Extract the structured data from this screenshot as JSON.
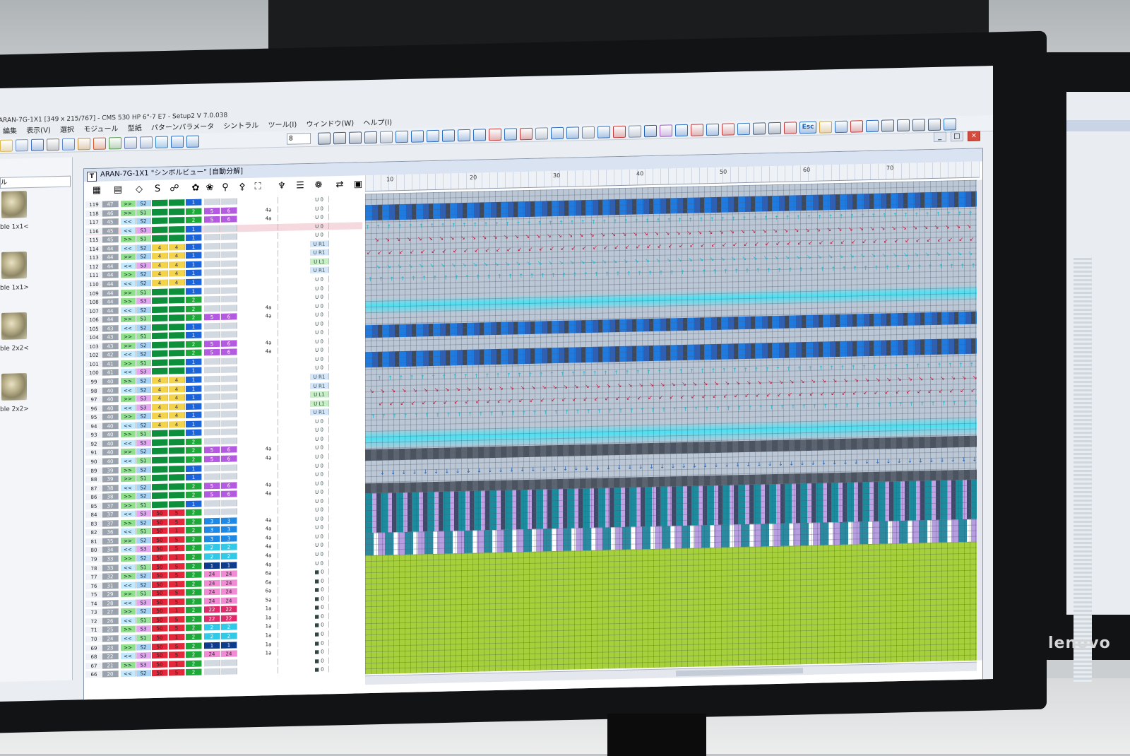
{
  "app": {
    "title": "ARAN-7G-1X1 [349 x 215/767] - CMS 530 HP 6\"-7 E7 - Setup2   V 7.0.038",
    "menu": [
      "編集",
      "表示(V)",
      "選択",
      "モジュール",
      "型紙",
      "パターンパラメータ",
      "シントラル",
      "ツール(I)",
      "ウィンドウ(W)",
      "ヘルプ(I)"
    ],
    "zoom_value": "8",
    "esc_label": "Esc",
    "window_controls": [
      "_",
      "□",
      "×"
    ]
  },
  "left_pane": {
    "combo_value": "ル",
    "thumbnails": [
      {
        "label": "ble 1x1<"
      },
      {
        "label": "ble 1x1>"
      },
      {
        "label": "ble 2x2<"
      },
      {
        "label": "ble 2x2>"
      }
    ]
  },
  "child_window": {
    "title": "ARAN-7G-1X1 \"シンボルビュー\" [自動分解]",
    "title_icon": "T",
    "toolbar_glyphs": [
      "▦",
      "▤",
      "◇",
      "S",
      "☍",
      "✿",
      "❀",
      "⚲",
      "⚴",
      "⛶",
      "♆",
      "☰",
      "❁",
      "⇄",
      "▣"
    ],
    "ruler_labels": [
      "10",
      "20",
      "30",
      "40",
      "50",
      "60",
      "70"
    ]
  },
  "rows": [
    {
      "n": "119",
      "a": "47",
      "b": ">>",
      "c": "S2",
      "d": "",
      "e": "",
      "f": "1",
      "g": "",
      "h": "",
      "i": "",
      "j": "U 0"
    },
    {
      "n": "118",
      "a": "46",
      "b": ">>",
      "c": "S1",
      "d": "",
      "e": "",
      "f": "2",
      "g": "5",
      "h": "6",
      "i": "4a",
      "j": "U 0"
    },
    {
      "n": "117",
      "a": "45",
      "b": "<<",
      "c": "S2",
      "d": "",
      "e": "",
      "f": "2",
      "g": "5",
      "h": "6",
      "i": "4a",
      "j": "U 0"
    },
    {
      "n": "116",
      "a": "45",
      "b": "<<",
      "c": "S3",
      "d": "",
      "e": "",
      "f": "1",
      "g": "",
      "h": "",
      "i": "",
      "j": "U 0",
      "hl": true
    },
    {
      "n": "115",
      "a": "45",
      "b": ">>",
      "c": "S1",
      "d": "",
      "e": "",
      "f": "1",
      "g": "",
      "h": "",
      "i": "",
      "j": "U 0"
    },
    {
      "n": "114",
      "a": "44",
      "b": "<<",
      "c": "S2",
      "d": "4",
      "e": "4",
      "f": "1",
      "g": "",
      "h": "",
      "i": "",
      "j": "U R1"
    },
    {
      "n": "113",
      "a": "44",
      "b": ">>",
      "c": "S2",
      "d": "4",
      "e": "4",
      "f": "1",
      "g": "",
      "h": "",
      "i": "",
      "j": "U R1"
    },
    {
      "n": "112",
      "a": "44",
      "b": "<<",
      "c": "S3",
      "d": "4",
      "e": "4",
      "f": "1",
      "g": "",
      "h": "",
      "i": "",
      "j": "U L1"
    },
    {
      "n": "111",
      "a": "44",
      "b": ">>",
      "c": "S2",
      "d": "4",
      "e": "4",
      "f": "1",
      "g": "",
      "h": "",
      "i": "",
      "j": "U R1"
    },
    {
      "n": "110",
      "a": "44",
      "b": "<<",
      "c": "S2",
      "d": "4",
      "e": "4",
      "f": "1",
      "g": "",
      "h": "",
      "i": "",
      "j": "U 0"
    },
    {
      "n": "109",
      "a": "44",
      "b": ">>",
      "c": "S1",
      "d": "",
      "e": "",
      "f": "1",
      "g": "",
      "h": "",
      "i": "",
      "j": "U 0"
    },
    {
      "n": "108",
      "a": "44",
      "b": ">>",
      "c": "S3",
      "d": "",
      "e": "",
      "f": "2",
      "g": "",
      "h": "",
      "i": "",
      "j": "U 0"
    },
    {
      "n": "107",
      "a": "44",
      "b": "<<",
      "c": "S2",
      "d": "",
      "e": "",
      "f": "2",
      "g": "",
      "h": "",
      "i": "4a",
      "j": "U 0"
    },
    {
      "n": "106",
      "a": "44",
      "b": ">>",
      "c": "S1",
      "d": "",
      "e": "",
      "f": "2",
      "g": "5",
      "h": "6",
      "i": "4a",
      "j": "U 0"
    },
    {
      "n": "105",
      "a": "43",
      "b": "<<",
      "c": "S2",
      "d": "",
      "e": "",
      "f": "1",
      "g": "",
      "h": "",
      "i": "",
      "j": "U 0"
    },
    {
      "n": "104",
      "a": "43",
      "b": ">>",
      "c": "S1",
      "d": "",
      "e": "",
      "f": "1",
      "g": "",
      "h": "",
      "i": "",
      "j": "U 0"
    },
    {
      "n": "103",
      "a": "43",
      "b": ">>",
      "c": "S2",
      "d": "",
      "e": "",
      "f": "2",
      "g": "5",
      "h": "6",
      "i": "4a",
      "j": "U 0"
    },
    {
      "n": "102",
      "a": "42",
      "b": "<<",
      "c": "S2",
      "d": "",
      "e": "",
      "f": "2",
      "g": "5",
      "h": "6",
      "i": "4a",
      "j": "U 0"
    },
    {
      "n": "101",
      "a": "41",
      "b": ">>",
      "c": "S1",
      "d": "",
      "e": "",
      "f": "1",
      "g": "",
      "h": "",
      "i": "",
      "j": "U 0"
    },
    {
      "n": "100",
      "a": "41",
      "b": "<<",
      "c": "S3",
      "d": "",
      "e": "",
      "f": "1",
      "g": "",
      "h": "",
      "i": "",
      "j": "U 0"
    },
    {
      "n": "99",
      "a": "40",
      "b": ">>",
      "c": "S2",
      "d": "4",
      "e": "4",
      "f": "1",
      "g": "",
      "h": "",
      "i": "",
      "j": "U R1"
    },
    {
      "n": "98",
      "a": "40",
      "b": "<<",
      "c": "S2",
      "d": "4",
      "e": "4",
      "f": "1",
      "g": "",
      "h": "",
      "i": "",
      "j": "U R1"
    },
    {
      "n": "97",
      "a": "40",
      "b": ">>",
      "c": "S3",
      "d": "4",
      "e": "4",
      "f": "1",
      "g": "",
      "h": "",
      "i": "",
      "j": "U L1"
    },
    {
      "n": "96",
      "a": "40",
      "b": "<<",
      "c": "S3",
      "d": "4",
      "e": "4",
      "f": "1",
      "g": "",
      "h": "",
      "i": "",
      "j": "U L1"
    },
    {
      "n": "95",
      "a": "40",
      "b": ">>",
      "c": "S2",
      "d": "4",
      "e": "4",
      "f": "1",
      "g": "",
      "h": "",
      "i": "",
      "j": "U R1"
    },
    {
      "n": "94",
      "a": "40",
      "b": "<<",
      "c": "S2",
      "d": "4",
      "e": "4",
      "f": "1",
      "g": "",
      "h": "",
      "i": "",
      "j": "U 0"
    },
    {
      "n": "93",
      "a": "40",
      "b": ">>",
      "c": "S1",
      "d": "",
      "e": "",
      "f": "1",
      "g": "",
      "h": "",
      "i": "",
      "j": "U 0"
    },
    {
      "n": "92",
      "a": "40",
      "b": "<<",
      "c": "S3",
      "d": "",
      "e": "",
      "f": "2",
      "g": "",
      "h": "",
      "i": "",
      "j": "U 0"
    },
    {
      "n": "91",
      "a": "40",
      "b": ">>",
      "c": "S2",
      "d": "",
      "e": "",
      "f": "2",
      "g": "5",
      "h": "6",
      "i": "4a",
      "j": "U 0"
    },
    {
      "n": "90",
      "a": "40",
      "b": "<<",
      "c": "S1",
      "d": "",
      "e": "",
      "f": "2",
      "g": "5",
      "h": "6",
      "i": "4a",
      "j": "U 0"
    },
    {
      "n": "89",
      "a": "39",
      "b": ">>",
      "c": "S2",
      "d": "",
      "e": "",
      "f": "1",
      "g": "",
      "h": "",
      "i": "",
      "j": "U 0"
    },
    {
      "n": "88",
      "a": "39",
      "b": ">>",
      "c": "S1",
      "d": "",
      "e": "",
      "f": "1",
      "g": "",
      "h": "",
      "i": "",
      "j": "U 0"
    },
    {
      "n": "87",
      "a": "38",
      "b": "<<",
      "c": "S2",
      "d": "",
      "e": "",
      "f": "2",
      "g": "5",
      "h": "6",
      "i": "4a",
      "j": "U 0"
    },
    {
      "n": "86",
      "a": "38",
      "b": ">>",
      "c": "S2",
      "d": "",
      "e": "",
      "f": "2",
      "g": "5",
      "h": "6",
      "i": "4a",
      "j": "U 0"
    },
    {
      "n": "85",
      "a": "37",
      "b": ">>",
      "c": "S1",
      "d": "",
      "e": "",
      "f": "1",
      "g": "",
      "h": "",
      "i": "",
      "j": "U 0"
    },
    {
      "n": "84",
      "a": "37",
      "b": "<<",
      "c": "S3",
      "d": "50",
      "e": "5",
      "f": "2",
      "g": "",
      "h": "",
      "i": "",
      "j": "U 0"
    },
    {
      "n": "83",
      "a": "37",
      "b": ">>",
      "c": "S2",
      "d": "50",
      "e": "5",
      "f": "2",
      "g": "3",
      "h": "3",
      "i": "4a",
      "j": "U 0"
    },
    {
      "n": "82",
      "a": "36",
      "b": "<<",
      "c": "S1",
      "d": "50",
      "e": "1",
      "f": "2",
      "g": "3",
      "h": "3",
      "i": "4a",
      "j": "U 0"
    },
    {
      "n": "81",
      "a": "35",
      "b": ">>",
      "c": "S2",
      "d": "50",
      "e": "5",
      "f": "2",
      "g": "3",
      "h": "3",
      "i": "4a",
      "j": "U 0"
    },
    {
      "n": "80",
      "a": "34",
      "b": "<<",
      "c": "S3",
      "d": "50",
      "e": "5",
      "f": "2",
      "g": "2",
      "h": "2",
      "i": "4a",
      "j": "U 0"
    },
    {
      "n": "79",
      "a": "33",
      "b": ">>",
      "c": "S2",
      "d": "50",
      "e": "1",
      "f": "2",
      "g": "2",
      "h": "2",
      "i": "4a",
      "j": "U 0"
    },
    {
      "n": "78",
      "a": "33",
      "b": "<<",
      "c": "S1",
      "d": "50",
      "e": "5",
      "f": "2",
      "g": "1",
      "h": "1",
      "i": "4a",
      "j": "U 0"
    },
    {
      "n": "77",
      "a": "32",
      "b": ">>",
      "c": "S2",
      "d": "50",
      "e": "5",
      "f": "2",
      "g": "24",
      "h": "24",
      "i": "6a",
      "j": "■ 0"
    },
    {
      "n": "76",
      "a": "31",
      "b": "<<",
      "c": "S2",
      "d": "50",
      "e": "1",
      "f": "2",
      "g": "24",
      "h": "24",
      "i": "6a",
      "j": "■ 0"
    },
    {
      "n": "75",
      "a": "29",
      "b": ">>",
      "c": "S1",
      "d": "50",
      "e": "5",
      "f": "2",
      "g": "24",
      "h": "24",
      "i": "6a",
      "j": "■ 0"
    },
    {
      "n": "74",
      "a": "28",
      "b": "<<",
      "c": "S3",
      "d": "50",
      "e": "5",
      "f": "2",
      "g": "24",
      "h": "24",
      "i": "5a",
      "j": "■ 0"
    },
    {
      "n": "73",
      "a": "27",
      "b": ">>",
      "c": "S2",
      "d": "50",
      "e": "1",
      "f": "2",
      "g": "22",
      "h": "22",
      "i": "1a",
      "j": "■ 0"
    },
    {
      "n": "72",
      "a": "26",
      "b": "<<",
      "c": "S1",
      "d": "50",
      "e": "5",
      "f": "2",
      "g": "22",
      "h": "22",
      "i": "1a",
      "j": "■ 0"
    },
    {
      "n": "71",
      "a": "25",
      "b": ">>",
      "c": "S3",
      "d": "50",
      "e": "5",
      "f": "2",
      "g": "2",
      "h": "2",
      "i": "1a",
      "j": "■ 0"
    },
    {
      "n": "70",
      "a": "24",
      "b": "<<",
      "c": "S1",
      "d": "50",
      "e": "1",
      "f": "2",
      "g": "2",
      "h": "2",
      "i": "1a",
      "j": "■ 0"
    },
    {
      "n": "69",
      "a": "23",
      "b": ">>",
      "c": "S2",
      "d": "50",
      "e": "5",
      "f": "2",
      "g": "1",
      "h": "1",
      "i": "1a",
      "j": "■ 0"
    },
    {
      "n": "68",
      "a": "22",
      "b": "<<",
      "c": "S3",
      "d": "50",
      "e": "5",
      "f": "2",
      "g": "24",
      "h": "24",
      "i": "1a",
      "j": "■ 0"
    },
    {
      "n": "67",
      "a": "21",
      "b": ">>",
      "c": "S3",
      "d": "50",
      "e": "1",
      "f": "2",
      "g": "",
      "h": "",
      "i": "",
      "j": "■ 0"
    },
    {
      "n": "66",
      "a": "20",
      "b": "<<",
      "c": "S2",
      "d": "50",
      "e": "5",
      "f": "2",
      "g": "",
      "h": "",
      "i": "",
      "j": "■ 0"
    }
  ],
  "colors": {
    "row_number_bg": "#eef1f5",
    "knit_band_blue": "#1f7be0",
    "rib_green": "#a7d13c",
    "cyan_cable": "#4fe0f2",
    "arrow_cyan": "#18b6cc",
    "arrow_red": "#c0163a"
  }
}
